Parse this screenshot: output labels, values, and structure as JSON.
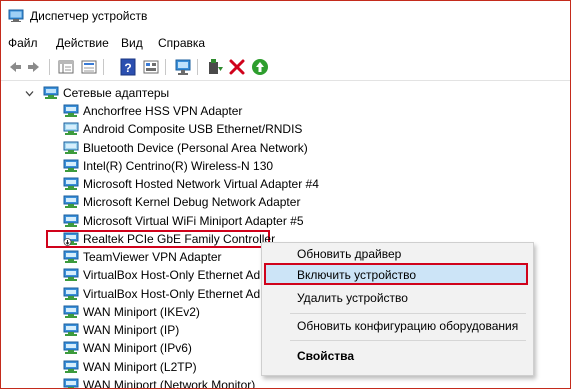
{
  "window": {
    "title": "Диспетчер устройств"
  },
  "menu": [
    "Файл",
    "Действие",
    "Вид",
    "Справка"
  ],
  "tree": {
    "category": "Сетевые адаптеры",
    "items": [
      "Anchorfree HSS VPN Adapter",
      "Android Composite USB Ethernet/RNDIS",
      "Bluetooth Device (Personal Area Network)",
      "Intel(R) Centrino(R) Wireless-N 130",
      "Microsoft Hosted Network Virtual Adapter #4",
      "Microsoft Kernel Debug Network Adapter",
      "Microsoft Virtual WiFi Miniport Adapter #5",
      "Realtek PCIe GbE Family Controller",
      "TeamViewer VPN Adapter",
      "VirtualBox Host-Only Ethernet Ad",
      "VirtualBox Host-Only Ethernet Ad",
      "WAN Miniport (IKEv2)",
      "WAN Miniport (IP)",
      "WAN Miniport (IPv6)",
      "WAN Miniport (L2TP)",
      "WAN Miniport (Network Monitor)"
    ],
    "selected_index": 7
  },
  "context_menu": {
    "items": [
      "Обновить драйвер",
      "Включить устройство",
      "Удалить устройство",
      "Обновить конфигурацию оборудования",
      "Свойства"
    ],
    "highlighted_index": 1
  },
  "colors": {
    "highlight_border": "#d0021b",
    "window_border": "#c42b1c",
    "menu_hover": "#cce4f7"
  }
}
